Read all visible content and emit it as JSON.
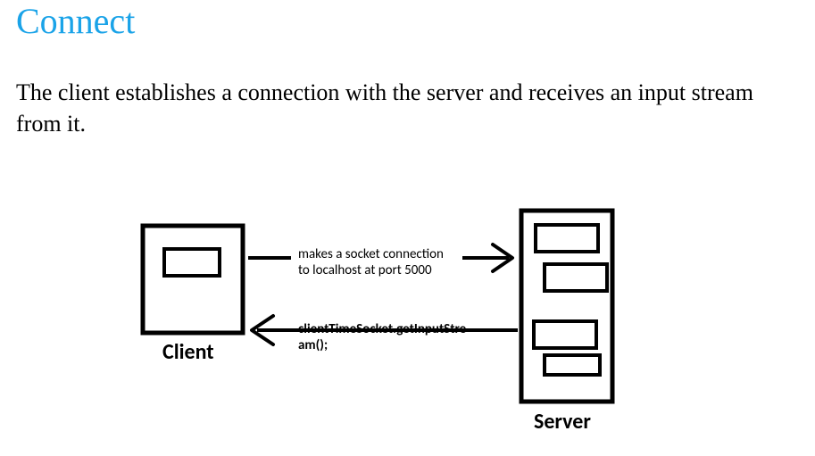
{
  "title": "Connect",
  "description": "The client establishes a connection with the server and receives an input stream from it.",
  "diagram": {
    "client_label": "Client",
    "server_label": "Server",
    "arrow_to_server_line1": "makes a socket connection",
    "arrow_to_server_line2": "to localhost at port 5000",
    "arrow_to_client_line1": "clientTimeSocket.getInputStre",
    "arrow_to_client_line2": "am();"
  }
}
